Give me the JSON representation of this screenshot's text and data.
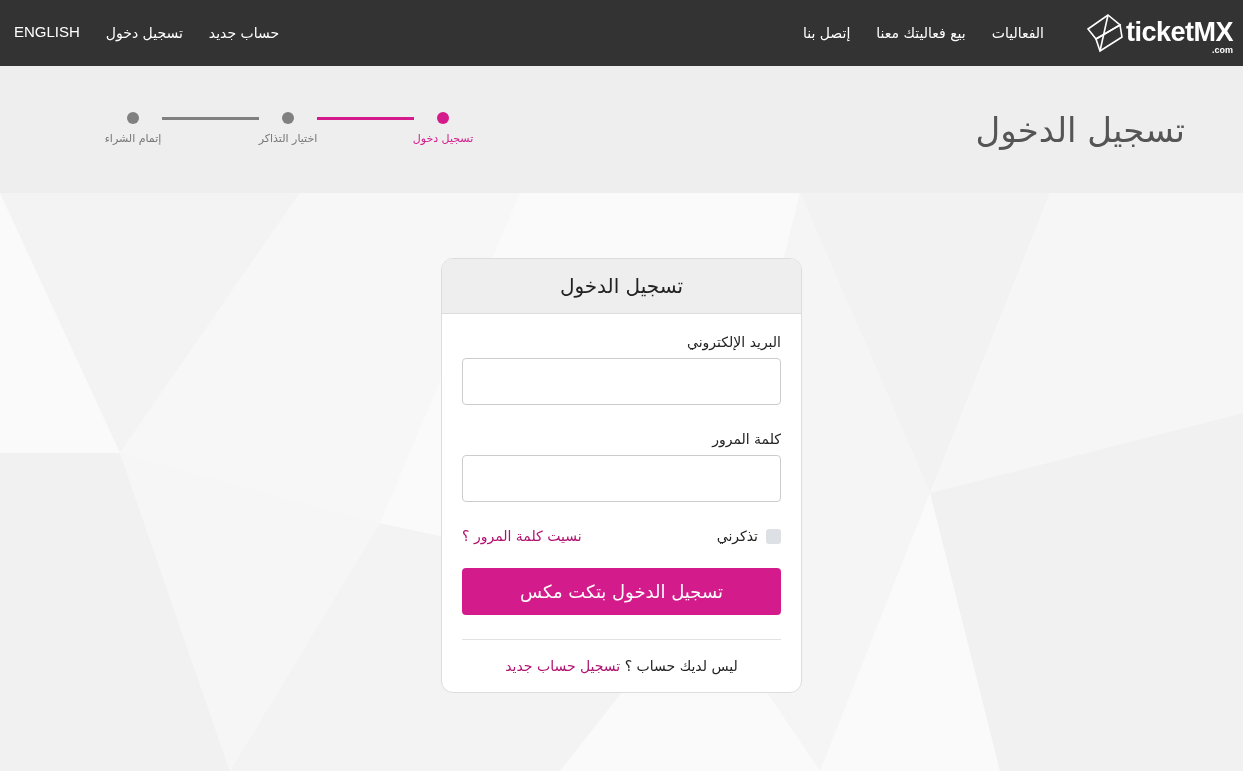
{
  "header": {
    "logo": {
      "text": "ticketMX",
      "suffix": ".com"
    },
    "nav": [
      "الفعاليات",
      "بيع فعاليتك معنا",
      "إتصل بنا"
    ],
    "account_links": [
      "حساب جديد",
      "تسجيل دخول"
    ],
    "language": "ENGLISH"
  },
  "hero": {
    "title": "تسجيل الدخول",
    "steps": [
      {
        "label": "تسجيل دخول",
        "active": true
      },
      {
        "label": "اختيار التذاكر",
        "active": false
      },
      {
        "label": "إتمام الشراء",
        "active": false
      }
    ]
  },
  "login_card": {
    "title": "تسجيل الدخول",
    "fields": [
      {
        "label": "البريد الإلكتروني"
      },
      {
        "label": "كلمة المرور"
      }
    ],
    "remember_me": {
      "label": "تذكرني",
      "checked": false
    },
    "forgot_link": "نسيت كلمة المرور ؟",
    "submit": "تسجيل الدخول بتكت مكس",
    "signup_prompt": "ليس لديك حساب ؟",
    "signup_link": "تسجيل حساب جديد"
  }
}
